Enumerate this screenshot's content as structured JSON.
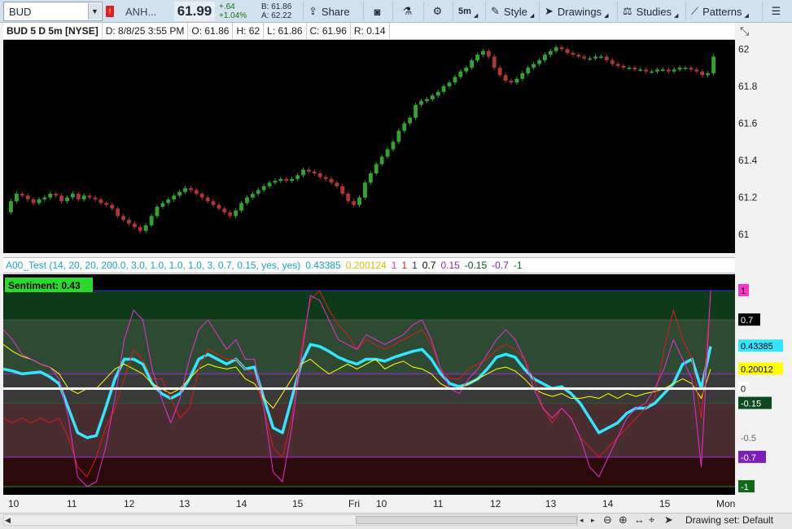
{
  "toolbar": {
    "symbol": "BUD",
    "alert_flag": "!",
    "description": "ANH...",
    "last_price": "61.99",
    "change": "+.64",
    "change_pct": "+1.04%",
    "bid": "B: 61.86",
    "ask": "A: 62.22",
    "share_label": "Share",
    "timeframe_label": "5m",
    "style_label": "Style",
    "drawings_label": "Drawings",
    "studies_label": "Studies",
    "patterns_label": "Patterns",
    "accent": "#d3e0ee"
  },
  "header": {
    "title": "BUD 5 D 5m [NYSE]",
    "date": "D: 8/8/25 3:55 PM",
    "open": "O: 61.86",
    "high": "H: 62",
    "low": "L: 61.86",
    "close": "C: 61.96",
    "range": "R: 0.14"
  },
  "price_axis": {
    "labels": [
      {
        "text": "62",
        "value": 62.0
      },
      {
        "text": "61.8",
        "value": 61.8
      },
      {
        "text": "61.6",
        "value": 61.6
      },
      {
        "text": "61.4",
        "value": 61.4
      },
      {
        "text": "61.2",
        "value": 61.2
      },
      {
        "text": "61",
        "value": 61.0
      }
    ]
  },
  "study": {
    "name": "A00_Test (14, 20, 20, 200.0, 3.0, 1.0, 1.0, 1.0, 3, 0.7, 0.15, yes, yes)",
    "value_cyan": "0.43385",
    "value_yellow": "0.200124",
    "level_1a": "1",
    "level_1b": "1",
    "level_1c": "1",
    "level_07": "0.7",
    "level_015": "0.15",
    "level_m015": "-0.15",
    "level_m07": "-0.7",
    "level_m1": "-1",
    "sentiment_label": "Sentiment: 0.43"
  },
  "osc_axis": {
    "labels": [
      {
        "text": "1",
        "value": 1.0,
        "bg": "#ff33cc",
        "fg": "#000000"
      },
      {
        "text": "0.7",
        "value": 0.7,
        "bg": "#000000",
        "fg": "#ffffff"
      },
      {
        "text": "0.43385",
        "value": 0.43385,
        "bg": "#33e6ff",
        "fg": "#000000"
      },
      {
        "text": "0.20012",
        "value": 0.20012,
        "bg": "#ffff00",
        "fg": "#000000"
      },
      {
        "text": "0",
        "value": 0.0,
        "bg": "#ffffff",
        "fg": "#000000"
      },
      {
        "text": "-0.15",
        "value": -0.15,
        "bg": "#0b4a1e",
        "fg": "#ffffff"
      },
      {
        "text": "-0.5",
        "value": -0.5,
        "bg": "",
        "fg": "#666666"
      },
      {
        "text": "-0.7",
        "value": -0.7,
        "bg": "#7a1fb8",
        "fg": "#ffffff"
      },
      {
        "text": "-1",
        "value": -1.0,
        "bg": "#0f6b1a",
        "fg": "#ffffff"
      }
    ]
  },
  "time_axis": {
    "labels": [
      "10",
      "11",
      "12",
      "13",
      "14",
      "15",
      "Fri",
      "10",
      "11",
      "12",
      "13",
      "14",
      "15",
      "Mon"
    ]
  },
  "status_bar": {
    "drawing_set": "Drawing set: Default"
  },
  "chart_data": {
    "type": "candlestick",
    "ylim": [
      60.9,
      62.05
    ],
    "open": [
      61.12,
      61.18,
      61.22,
      61.21,
      61.19,
      61.17,
      61.19,
      61.2,
      61.22,
      61.21,
      61.18,
      61.2,
      61.22,
      61.19,
      61.21,
      61.2,
      61.19,
      61.17,
      61.16,
      61.14,
      61.1,
      61.08,
      61.06,
      61.04,
      61.02,
      61.05,
      61.1,
      61.15,
      61.17,
      61.19,
      61.21,
      61.23,
      61.25,
      61.24,
      61.22,
      61.2,
      61.18,
      61.16,
      61.14,
      61.12,
      61.1,
      61.13,
      61.17,
      61.2,
      61.22,
      61.24,
      61.26,
      61.28,
      61.29,
      61.3,
      61.29,
      61.3,
      61.32,
      61.35,
      61.34,
      61.33,
      61.31,
      61.3,
      61.28,
      61.26,
      61.22,
      61.18,
      61.16,
      61.2,
      61.28,
      61.33,
      61.38,
      61.42,
      61.46,
      61.5,
      61.56,
      61.6,
      61.63,
      61.7,
      61.72,
      61.73,
      61.75,
      61.77,
      61.8,
      61.82,
      61.85,
      61.88,
      61.9,
      61.94,
      61.97,
      61.99,
      61.96,
      61.9,
      61.86,
      61.83,
      61.82,
      61.84,
      61.87,
      61.9,
      61.92,
      61.94,
      61.97,
      61.99,
      62.01,
      62.0,
      61.98,
      61.97,
      61.96,
      61.95,
      61.95,
      61.96,
      61.96,
      61.94,
      61.92,
      61.91,
      61.9,
      61.9,
      61.89,
      61.89,
      61.88,
      61.88,
      61.89,
      61.89,
      61.88,
      61.89,
      61.9,
      61.9,
      61.89,
      61.88,
      61.86,
      61.87
    ],
    "close": [
      61.18,
      61.22,
      61.21,
      61.19,
      61.17,
      61.19,
      61.2,
      61.22,
      61.21,
      61.18,
      61.2,
      61.22,
      61.19,
      61.21,
      61.2,
      61.19,
      61.17,
      61.16,
      61.14,
      61.1,
      61.08,
      61.06,
      61.04,
      61.02,
      61.05,
      61.1,
      61.15,
      61.17,
      61.19,
      61.21,
      61.23,
      61.25,
      61.24,
      61.22,
      61.2,
      61.18,
      61.16,
      61.14,
      61.12,
      61.1,
      61.13,
      61.17,
      61.2,
      61.22,
      61.24,
      61.26,
      61.28,
      61.29,
      61.3,
      61.29,
      61.3,
      61.32,
      61.35,
      61.34,
      61.33,
      61.31,
      61.3,
      61.28,
      61.26,
      61.22,
      61.18,
      61.16,
      61.2,
      61.28,
      61.33,
      61.38,
      61.42,
      61.46,
      61.5,
      61.56,
      61.6,
      61.63,
      61.7,
      61.72,
      61.73,
      61.75,
      61.77,
      61.8,
      61.82,
      61.85,
      61.88,
      61.9,
      61.94,
      61.97,
      61.99,
      61.96,
      61.9,
      61.86,
      61.83,
      61.82,
      61.84,
      61.87,
      61.9,
      61.92,
      61.94,
      61.97,
      61.99,
      62.01,
      62.0,
      61.98,
      61.97,
      61.96,
      61.95,
      61.95,
      61.96,
      61.96,
      61.94,
      61.92,
      61.91,
      61.9,
      61.9,
      61.89,
      61.89,
      61.88,
      61.88,
      61.89,
      61.89,
      61.88,
      61.89,
      61.9,
      61.9,
      61.89,
      61.88,
      61.86,
      61.87,
      61.96
    ]
  },
  "oscillator_data": {
    "type": "line",
    "ylim": [
      -1.0,
      1.0
    ],
    "bands": [
      0.7,
      0.15,
      -0.15,
      -0.7
    ],
    "series": [
      {
        "color": "#33e6ff",
        "values": [
          0.2,
          0.18,
          0.15,
          0.16,
          0.17,
          0.12,
          0.05,
          -0.2,
          -0.45,
          -0.5,
          -0.48,
          -0.2,
          0.1,
          0.3,
          0.3,
          0.25,
          0.05,
          -0.05,
          -0.1,
          -0.05,
          0.1,
          0.3,
          0.35,
          0.3,
          0.25,
          0.3,
          0.2,
          0.22,
          -0.1,
          -0.4,
          -0.45,
          -0.1,
          0.25,
          0.45,
          0.43,
          0.38,
          0.32,
          0.28,
          0.25,
          0.3,
          0.3,
          0.28,
          0.32,
          0.35,
          0.38,
          0.4,
          0.3,
          0.15,
          0.05,
          0.02,
          0.05,
          0.1,
          0.2,
          0.32,
          0.35,
          0.32,
          0.2,
          0.1,
          0.05,
          0.0,
          0.02,
          -0.05,
          -0.15,
          -0.3,
          -0.45,
          -0.4,
          -0.35,
          -0.25,
          -0.2,
          -0.2,
          -0.15,
          -0.05,
          0.05,
          0.25,
          0.3,
          0.0,
          0.43
        ]
      },
      {
        "color": "#ffff00",
        "values": [
          0.45,
          0.38,
          0.33,
          0.3,
          0.25,
          0.22,
          0.15,
          0.0,
          -0.05,
          0.0,
          0.0,
          0.1,
          0.2,
          0.25,
          0.2,
          0.15,
          0.05,
          0.0,
          -0.05,
          0.0,
          0.1,
          0.2,
          0.25,
          0.22,
          0.2,
          0.22,
          0.1,
          0.05,
          -0.1,
          -0.2,
          -0.05,
          0.1,
          0.25,
          0.3,
          0.22,
          0.15,
          0.2,
          0.25,
          0.2,
          0.25,
          0.3,
          0.2,
          0.25,
          0.28,
          0.22,
          0.2,
          0.15,
          0.05,
          0.0,
          0.0,
          0.05,
          0.1,
          0.15,
          0.2,
          0.22,
          0.18,
          0.1,
          0.0,
          -0.05,
          -0.08,
          -0.05,
          -0.1,
          -0.1,
          -0.08,
          -0.1,
          -0.05,
          -0.1,
          -0.05,
          -0.08,
          -0.05,
          -0.03,
          0.0,
          0.05,
          0.1,
          0.05,
          -0.1,
          0.2
        ]
      },
      {
        "color": "#e01a1a",
        "values": [
          -0.3,
          -0.35,
          -0.3,
          -0.35,
          -0.3,
          -0.35,
          -0.3,
          -0.5,
          -0.8,
          -0.9,
          -0.7,
          -0.4,
          -0.2,
          0.1,
          0.4,
          0.3,
          0.1,
          0.1,
          -0.1,
          -0.3,
          -0.2,
          0.2,
          0.4,
          0.35,
          0.3,
          0.3,
          0.2,
          0.15,
          -0.2,
          -0.6,
          -0.7,
          -0.3,
          0.4,
          0.9,
          1.0,
          0.8,
          0.65,
          0.55,
          0.4,
          0.5,
          0.45,
          0.4,
          0.45,
          0.5,
          0.55,
          0.6,
          0.45,
          0.2,
          0.1,
          0.1,
          0.2,
          0.25,
          0.3,
          0.4,
          0.45,
          0.4,
          0.3,
          0.1,
          -0.2,
          -0.35,
          -0.2,
          -0.3,
          -0.5,
          -0.6,
          -0.7,
          -0.6,
          -0.5,
          -0.4,
          -0.3,
          -0.2,
          -0.1,
          0.4,
          0.8,
          0.5,
          0.3,
          -0.3,
          0.95
        ]
      },
      {
        "color": "#e62ed4",
        "values": [
          0.6,
          0.5,
          0.35,
          0.3,
          0.25,
          0.22,
          0.1,
          -0.3,
          -0.9,
          -1.0,
          -0.95,
          -0.6,
          -0.1,
          0.5,
          0.8,
          0.7,
          0.2,
          -0.1,
          -0.35,
          -0.1,
          0.3,
          0.6,
          0.7,
          0.55,
          0.4,
          0.5,
          0.3,
          0.3,
          -0.2,
          -0.85,
          -0.95,
          -0.4,
          0.3,
          0.95,
          0.9,
          0.7,
          0.5,
          0.45,
          0.4,
          0.55,
          0.5,
          0.45,
          0.5,
          0.55,
          0.65,
          0.7,
          0.5,
          0.2,
          0.0,
          -0.05,
          0.1,
          0.2,
          0.35,
          0.5,
          0.6,
          0.5,
          0.3,
          0.0,
          -0.2,
          -0.3,
          -0.2,
          -0.3,
          -0.5,
          -0.8,
          -0.9,
          -0.7,
          -0.5,
          -0.3,
          -0.2,
          -0.15,
          0.0,
          0.2,
          0.5,
          0.3,
          0.1,
          -0.8,
          1.0
        ]
      },
      {
        "color": "#ffffff",
        "values": [
          0.0,
          0.0
        ]
      }
    ]
  }
}
